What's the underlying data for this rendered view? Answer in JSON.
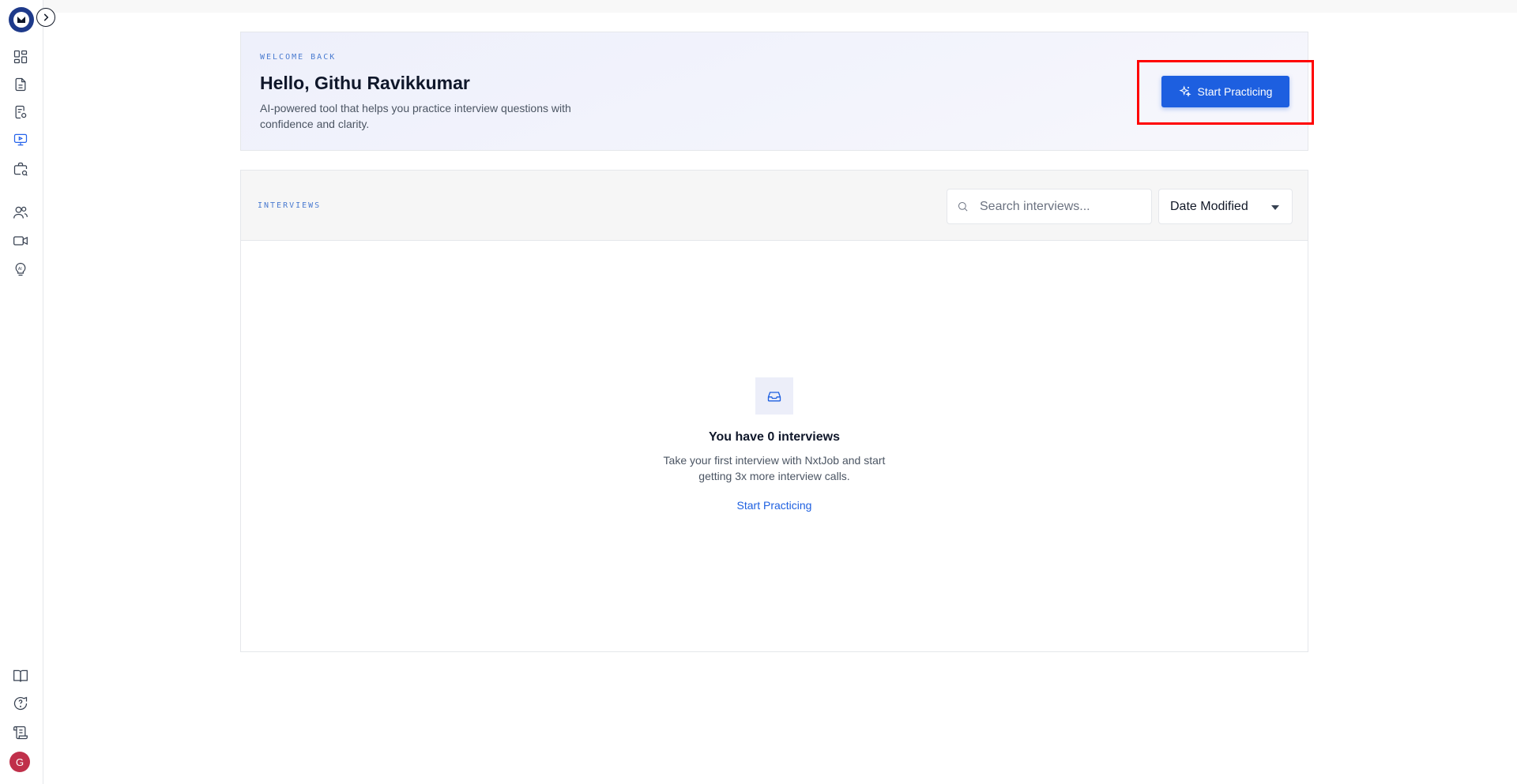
{
  "welcome": {
    "eyebrow": "WELCOME BACK",
    "greeting": "Hello, Githu Ravikkumar",
    "subtitle": "AI-powered tool that helps you practice interview questions with confidence and clarity.",
    "cta_label": "Start Practicing"
  },
  "interviews": {
    "section_label": "INTERVIEWS",
    "search_placeholder": "Search interviews...",
    "sort_value": "Date Modified",
    "empty_title": "You have 0 interviews",
    "empty_desc": "Take your first interview with NxtJob and start getting 3x more interview calls.",
    "empty_link": "Start Practicing"
  },
  "user": {
    "avatar_initial": "G"
  },
  "colors": {
    "accent": "#1d5fe0",
    "highlight": "#ff0000",
    "avatar": "#c0304a"
  }
}
